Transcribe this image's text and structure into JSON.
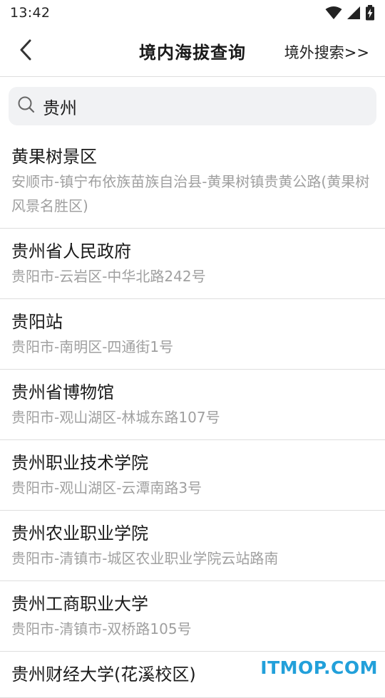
{
  "status_bar": {
    "time": "13:42",
    "icons": [
      "wifi-icon",
      "signal-icon",
      "battery-charging-icon"
    ]
  },
  "header": {
    "back_icon": "chevron-left-icon",
    "title": "境内海拔查询",
    "abroad_link": "境外搜索>>"
  },
  "search": {
    "icon": "search-icon",
    "value": "贵州",
    "background": "#f1f2f4"
  },
  "results": [
    {
      "name": "黄果树景区",
      "address": "安顺市-镇宁布依族苗族自治县-黄果树镇贵黄公路(黄果树风景名胜区)"
    },
    {
      "name": "贵州省人民政府",
      "address": "贵阳市-云岩区-中华北路242号"
    },
    {
      "name": "贵阳站",
      "address": "贵阳市-南明区-四通街1号"
    },
    {
      "name": "贵州省博物馆",
      "address": "贵阳市-观山湖区-林城东路107号"
    },
    {
      "name": "贵州职业技术学院",
      "address": "贵阳市-观山湖区-云潭南路3号"
    },
    {
      "name": "贵州农业职业学院",
      "address": "贵阳市-清镇市-城区农业职业学院云站路南"
    },
    {
      "name": "贵州工商职业大学",
      "address": "贵阳市-清镇市-双桥路105号"
    },
    {
      "name": "贵州财经大学(花溪校区)",
      "address": ""
    }
  ],
  "watermark": "ITMOP.COM",
  "colors": {
    "text_primary": "#1a1a1a",
    "text_secondary": "#a0a0a0",
    "divider": "#dedede",
    "watermark": "#22a0da"
  }
}
